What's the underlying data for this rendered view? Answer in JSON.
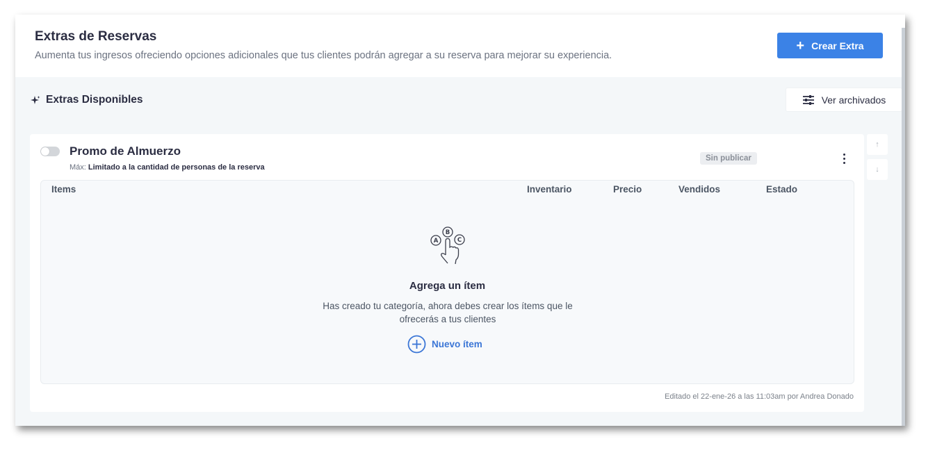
{
  "header": {
    "title": "Extras de Reservas",
    "subtitle": "Aumenta tus ingresos ofreciendo opciones adicionales que tus clientes podrán agregar a su reserva para mejorar su experiencia.",
    "create_button": "Crear Extra"
  },
  "section": {
    "title": "Extras Disponibles",
    "archive_button": "Ver archivados"
  },
  "extra": {
    "name": "Promo de Almuerzo",
    "max_label": "Máx:",
    "max_value": "Limitado a la cantidad de personas de la reserva",
    "status": "Sin publicar",
    "enabled": false,
    "columns": [
      "Items",
      "Inventario",
      "Precio",
      "Vendidos",
      "Estado"
    ],
    "empty": {
      "title": "Agrega un ítem",
      "description": "Has creado tu categoría, ahora debes crear los ítems que le ofrecerás a tus clientes",
      "action": "Nuevo ítem"
    },
    "edited": "Editado el 22-ene-26 a las 11:03am por Andrea Donado"
  },
  "colors": {
    "primary": "#3b82e6",
    "link": "#3b76d6",
    "text": "#2b2d42",
    "muted": "#6b7280",
    "background": "#f4f7f9"
  },
  "icons": [
    "plus-icon",
    "sparkle-icon",
    "sliders-icon",
    "toggle-switch",
    "kebab-menu-icon",
    "abc-choice-icon",
    "add-circle-icon",
    "arrow-up-icon",
    "arrow-down-icon"
  ]
}
